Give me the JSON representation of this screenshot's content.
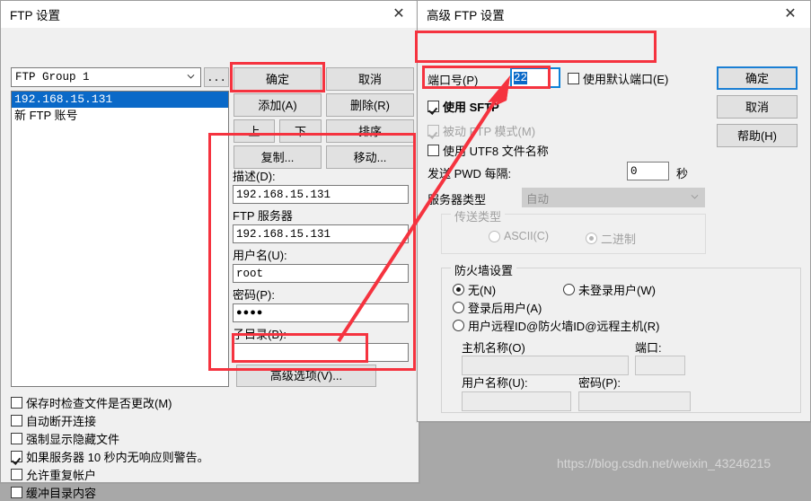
{
  "desktop": {
    "watermark": "https://blog.csdn.net/weixin_43246215",
    "background_color": "#a8a8a8"
  },
  "accent": {
    "selection_blue": "#0a69c8",
    "focus_blue": "#1a7fd4",
    "annotation_red": "#f5333f"
  },
  "ftp_settings_dialog": {
    "title": "FTP 设置",
    "close_icon": "close-icon",
    "group_combo": {
      "value": "FTP Group 1",
      "dropdown_icon": "chevron-down-icon"
    },
    "browse_button": "...",
    "account_list": [
      {
        "label": "192.168.15.131",
        "selected": true
      },
      {
        "label": "新 FTP 账号",
        "selected": false
      }
    ],
    "buttons": {
      "ok": "确定",
      "cancel": "取消",
      "add": "添加(A)",
      "remove": "删除(R)",
      "up": "上",
      "down": "下",
      "sort": "排序",
      "copy": "复制...",
      "move": "移动...",
      "advanced": "高级选项(V)..."
    },
    "fields": [
      {
        "label": "描述(D):",
        "value": "192.168.15.131",
        "name": "description"
      },
      {
        "label": "FTP 服务器",
        "value": "192.168.15.131",
        "name": "ftp-server"
      },
      {
        "label": "用户名(U):",
        "value": "root",
        "name": "username"
      },
      {
        "label": "密码(P):",
        "value": "●●●●",
        "name": "password"
      },
      {
        "label": "子目录(B):",
        "value": "",
        "name": "subdirectory"
      }
    ],
    "options": [
      {
        "label": "保存时检查文件是否更改(M)",
        "checked": false
      },
      {
        "label": "自动断开连接",
        "checked": false
      },
      {
        "label": "强制显示隐藏文件",
        "checked": false
      },
      {
        "label": "如果服务器 10 秒内无响应则警告。",
        "checked": true
      },
      {
        "label": "允许重复帐户",
        "checked": false
      },
      {
        "label": "缓冲目录内容",
        "checked": false
      }
    ]
  },
  "advanced_ftp_dialog": {
    "title": "高级 FTP 设置",
    "close_icon": "close-icon",
    "port": {
      "label": "端口号(P)",
      "value": "22",
      "selected": true
    },
    "use_default_port": {
      "label": "使用默认端口(E)",
      "checked": false
    },
    "use_sftp": {
      "label": "使用 SFTP",
      "checked": true,
      "disabled": false
    },
    "passive_ftp": {
      "label": "被动 FTP 模式(M)",
      "checked": true,
      "disabled": true
    },
    "use_utf8": {
      "label": "使用 UTF8 文件名称",
      "checked": false,
      "disabled": false
    },
    "send_pwd": {
      "label": "发送 PWD 每隔:",
      "value": "0",
      "unit": "秒"
    },
    "server_type": {
      "label": "服务器类型",
      "value": "自动",
      "disabled": true,
      "dropdown_icon": "chevron-down-icon"
    },
    "transfer_type": {
      "title": "传送类型",
      "disabled": true,
      "options": [
        {
          "label": "ASCII(C)",
          "checked": false
        },
        {
          "label": "二进制",
          "checked": true
        }
      ]
    },
    "firewall": {
      "title": "防火墙设置",
      "radios": [
        {
          "label": "无(N)",
          "checked": true
        },
        {
          "label": "未登录用户(W)",
          "checked": false
        },
        {
          "label": "登录后用户(A)",
          "checked": false
        },
        {
          "label": "用户远程ID@防火墙ID@远程主机(R)",
          "checked": false
        }
      ],
      "host_label": "主机名称(O)",
      "host_value": "",
      "port_label": "端口:",
      "port_value": "",
      "user_label": "用户名称(U):",
      "user_value": "",
      "pass_label": "密码(P):",
      "pass_value": ""
    },
    "buttons": {
      "ok": "确定",
      "cancel": "取消",
      "help": "帮助(H)"
    }
  }
}
